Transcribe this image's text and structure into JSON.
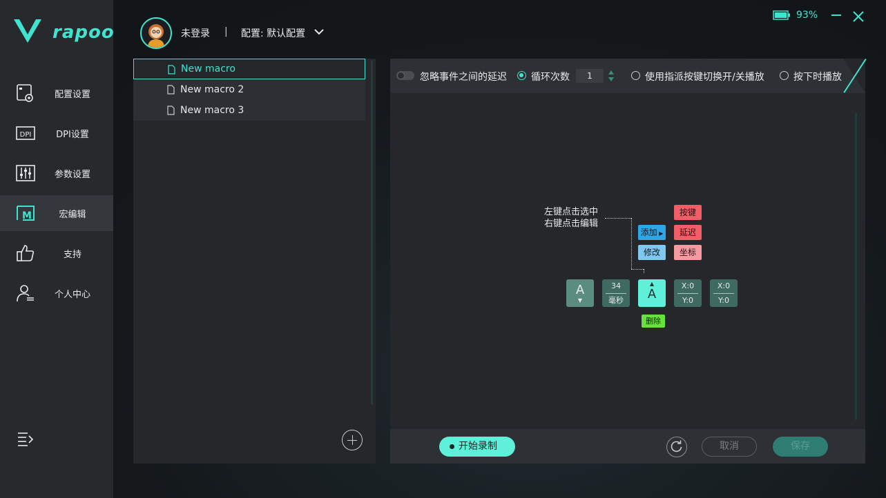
{
  "brand": {
    "name": "rapoo",
    "accent": "#3fe3cf"
  },
  "sidebar": {
    "items": [
      {
        "label": "配置设置",
        "icon": "profile-settings-icon"
      },
      {
        "label": "DPI设置",
        "icon": "dpi-icon"
      },
      {
        "label": "参数设置",
        "icon": "sliders-icon"
      },
      {
        "label": "宏编辑",
        "icon": "macro-icon",
        "active": true
      },
      {
        "label": "支持",
        "icon": "thumbs-up-icon"
      },
      {
        "label": "个人中心",
        "icon": "user-icon"
      }
    ]
  },
  "header": {
    "user": "未登录",
    "separator": "|",
    "profile": "配置: 默认配置"
  },
  "status": {
    "battery": "93%"
  },
  "macros": [
    {
      "label": "New macro",
      "selected": true
    },
    {
      "label": "New macro 2"
    },
    {
      "label": "New macro 3"
    }
  ],
  "toolbar": {
    "ignore_delay": "忽略事件之间的延迟",
    "loop_count_label": "循环次数",
    "loop_count_value": "1",
    "toggle_by_key": "使用指派按键切换开/关播放",
    "play_while_pressed": "按下时播放"
  },
  "hint": {
    "line1": "左键点击选中",
    "line2": "右键点击编辑"
  },
  "context_menu": {
    "add": "添加",
    "modify": "修改",
    "key": "按键",
    "delay": "延迟",
    "coord": "坐标",
    "delete": "删除"
  },
  "events": [
    {
      "type": "key-down",
      "label": "A"
    },
    {
      "type": "delay",
      "value": "34",
      "unit": "毫秒"
    },
    {
      "type": "key-up",
      "label": "A"
    },
    {
      "type": "coord",
      "x": "X:0",
      "y": "Y:0"
    },
    {
      "type": "coord",
      "x": "X:0",
      "y": "Y:0"
    }
  ],
  "bottom": {
    "record": "开始录制",
    "cancel": "取消",
    "save": "保存"
  }
}
